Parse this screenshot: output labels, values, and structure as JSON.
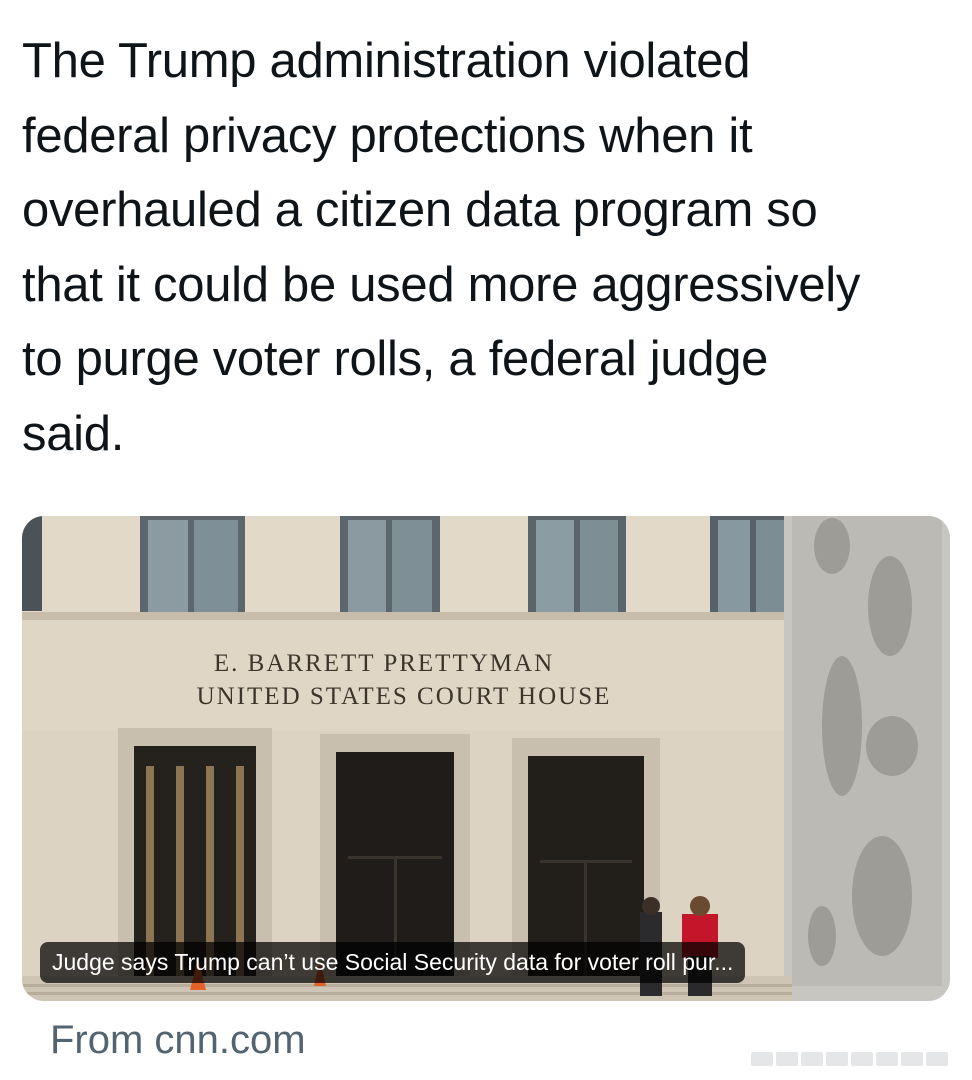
{
  "tweet": {
    "text": "The Trump administration violated\nfederal privacy protections when it\noverhauled a citizen data program so\nthat it could be used more aggressively\nto purge voter rolls, a federal judge\nsaid."
  },
  "link_card": {
    "image_sign_line1": "E. BARRETT  PRETTYMAN",
    "image_sign_line2": "UNITED  STATES  COURT  HOUSE",
    "headline": "Judge says Trump can’t use Social Security data for voter roll pur...",
    "source": "From cnn.com"
  },
  "colors": {
    "text": "#0f1419",
    "secondary_text": "#536471",
    "facade": "#d9d0c0",
    "door": "#1f1c19"
  }
}
